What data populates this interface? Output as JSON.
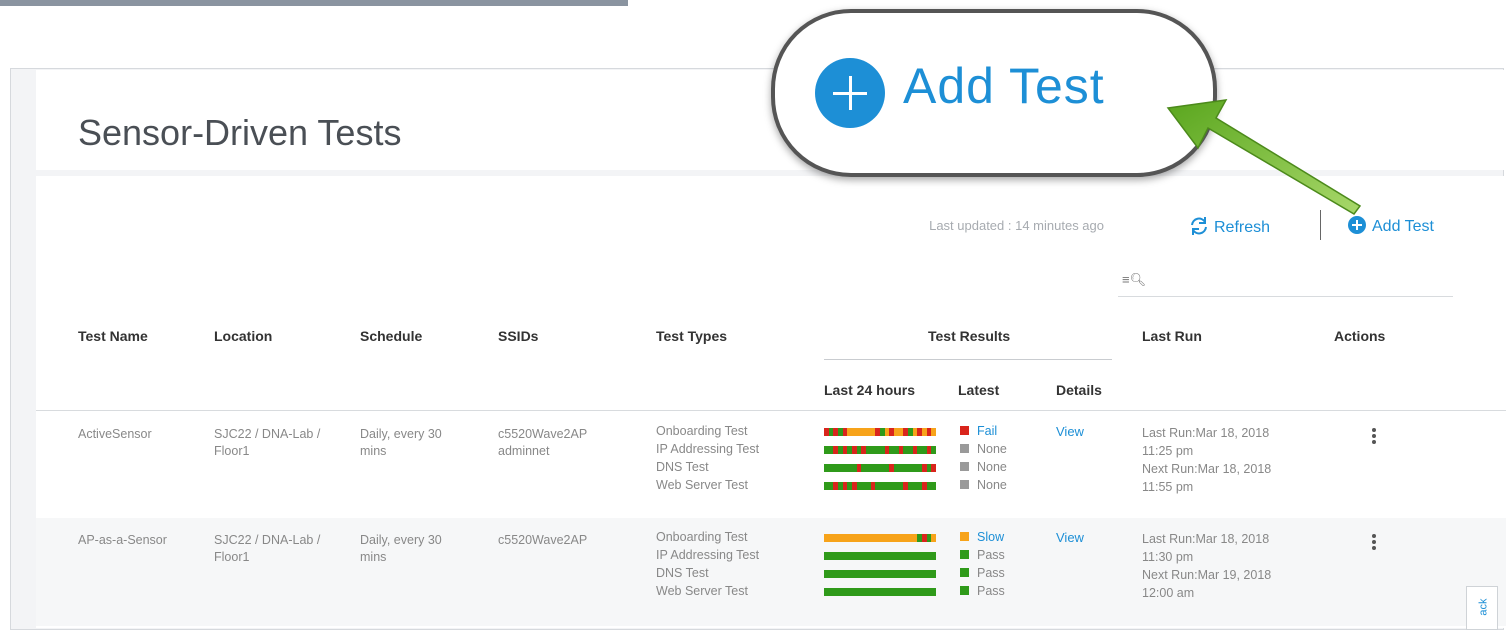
{
  "page": {
    "title": "Sensor-Driven Tests"
  },
  "toolbar": {
    "last_updated": "Last updated : 14 minutes ago",
    "refresh_label": "Refresh",
    "add_test_label": "Add Test"
  },
  "search": {
    "icon": "search-list-icon",
    "placeholder": ""
  },
  "table": {
    "headers": {
      "test_name": "Test Name",
      "location": "Location",
      "schedule": "Schedule",
      "ssids": "SSIDs",
      "test_types": "Test Types",
      "test_results": "Test Results",
      "last_24": "Last 24 hours",
      "latest": "Latest",
      "details": "Details",
      "last_run": "Last Run",
      "actions": "Actions"
    },
    "rows": [
      {
        "name": "ActiveSensor",
        "location": "SJC22 / DNA-Lab /\nFloor1",
        "schedule": "Daily, every 30\nmins",
        "ssids": "c5520Wave2AP\nadminnet",
        "types": [
          "Onboarding Test",
          "IP Addressing Test",
          "DNS Test",
          "Web Server Test"
        ],
        "latest": [
          {
            "label": "Fail",
            "color": "#d9251c",
            "link": true
          },
          {
            "label": "None",
            "color": "#9a9a9a",
            "link": false
          },
          {
            "label": "None",
            "color": "#9a9a9a",
            "link": false
          },
          {
            "label": "None",
            "color": "#9a9a9a",
            "link": false
          }
        ],
        "details": "View",
        "last_run": "Last Run:Mar 18, 2018\n11:25 pm\nNext Run:Mar 18, 2018\n11:55 pm"
      },
      {
        "name": "AP-as-a-Sensor",
        "location": "SJC22 / DNA-Lab /\nFloor1",
        "schedule": "Daily, every 30\nmins",
        "ssids": "c5520Wave2AP",
        "types": [
          "Onboarding Test",
          "IP Addressing Test",
          "DNS Test",
          "Web Server Test"
        ],
        "latest": [
          {
            "label": "Slow",
            "color": "#f7a31a",
            "link": true
          },
          {
            "label": "Pass",
            "color": "#2f9a1a",
            "link": false
          },
          {
            "label": "Pass",
            "color": "#2f9a1a",
            "link": false
          },
          {
            "label": "Pass",
            "color": "#2f9a1a",
            "link": false
          }
        ],
        "details": "View",
        "last_run": "Last Run:Mar 18, 2018\n11:30 pm\nNext Run:Mar 19, 2018\n12:00 am"
      }
    ]
  },
  "colors": {
    "pass": "#2f9a1a",
    "fail": "#d9251c",
    "slow": "#f7a31a",
    "none": "#9a9a9a",
    "accent": "#1d8fd6"
  },
  "callout": {
    "label": "Add Test"
  },
  "feedback": {
    "label": "ack"
  }
}
